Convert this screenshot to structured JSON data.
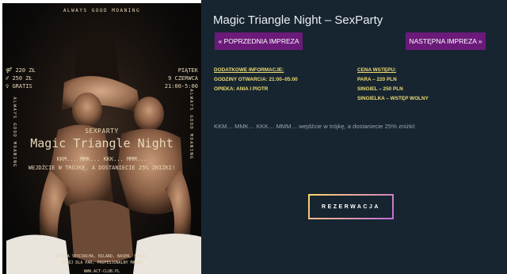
{
  "poster": {
    "tagline_top": "ALWAYS GOOD MOANING",
    "prices": [
      {
        "icon": "gender-couple-icon",
        "symbol": "⚤",
        "text": "220 ZŁ"
      },
      {
        "icon": "gender-male-icon",
        "symbol": "♂",
        "text": "250 ZŁ"
      },
      {
        "icon": "gender-female-icon",
        "symbol": "♀",
        "text": "GRATIS"
      }
    ],
    "date": [
      "PIĄTEK",
      "9 CZERWCA",
      "21:00-5:00"
    ],
    "side_text_left": "ALWAYS GOOD MOANING",
    "side_text_right": "ALWAYS GOOD MOANING",
    "kicker": "SEXPARTY",
    "title": "Magic Triangle Night",
    "line1": "KKM... MMK... KKK... MMM...",
    "line2": "WEJDŹCIE W TRÓJKĘ, A DOSTANIECIE 25% ZNIŻKI!",
    "amenities_1": "OPIEKA SEXCOACHA, BILARD, BASEN, SAUNA,",
    "amenities_2": "POKÓJ DLA PAR, PROFESJONALNY MASAŻ",
    "url": "WWW.ACT-CLUB.PL"
  },
  "event": {
    "title": "Magic Triangle Night – SexParty",
    "prev_label": "« POPRZEDNIA IMPREZA",
    "next_label": "NASTĘPNA IMPREZA »",
    "info_heading": "DODATKOWE INFORMACJE:",
    "hours": "GODZINY OTWARCIA: 21:00–05:00",
    "care": "OPIEKA: ANIA I PIOTR",
    "price_heading": "CENA WSTĘPU:",
    "price_couple": "PARA – 220 PLN",
    "price_single": "SINGIEL – 250 PLN",
    "price_single_f": "SINGIELKA – WSTĘP WOLNY",
    "description": "KKM… MMK… KKK… MMM… wejdźcie w trójkę, a dostaniecie 25% zniżki!",
    "reserve_label": "REZERWACJA"
  },
  "colors": {
    "panel_bg": "#172530",
    "accent_purple": "#6b1a7a",
    "info_yellow": "#ecdc73"
  }
}
